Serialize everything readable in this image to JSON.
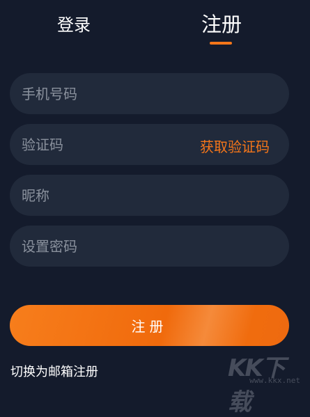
{
  "tabs": {
    "login": "登录",
    "register": "注册",
    "active": "register"
  },
  "form": {
    "phone_placeholder": "手机号码",
    "code_placeholder": "验证码",
    "get_code": "获取验证码",
    "nickname_placeholder": "昵称",
    "password_placeholder": "设置密码",
    "submit": "注册"
  },
  "switch_link": "切换为邮箱注册",
  "watermark": {
    "logo": "KK下载",
    "url": "www.kkx.net"
  },
  "colors": {
    "background": "#141b2c",
    "field": "#212a3b",
    "accent": "#f5761a",
    "placeholder": "#8a919d"
  }
}
